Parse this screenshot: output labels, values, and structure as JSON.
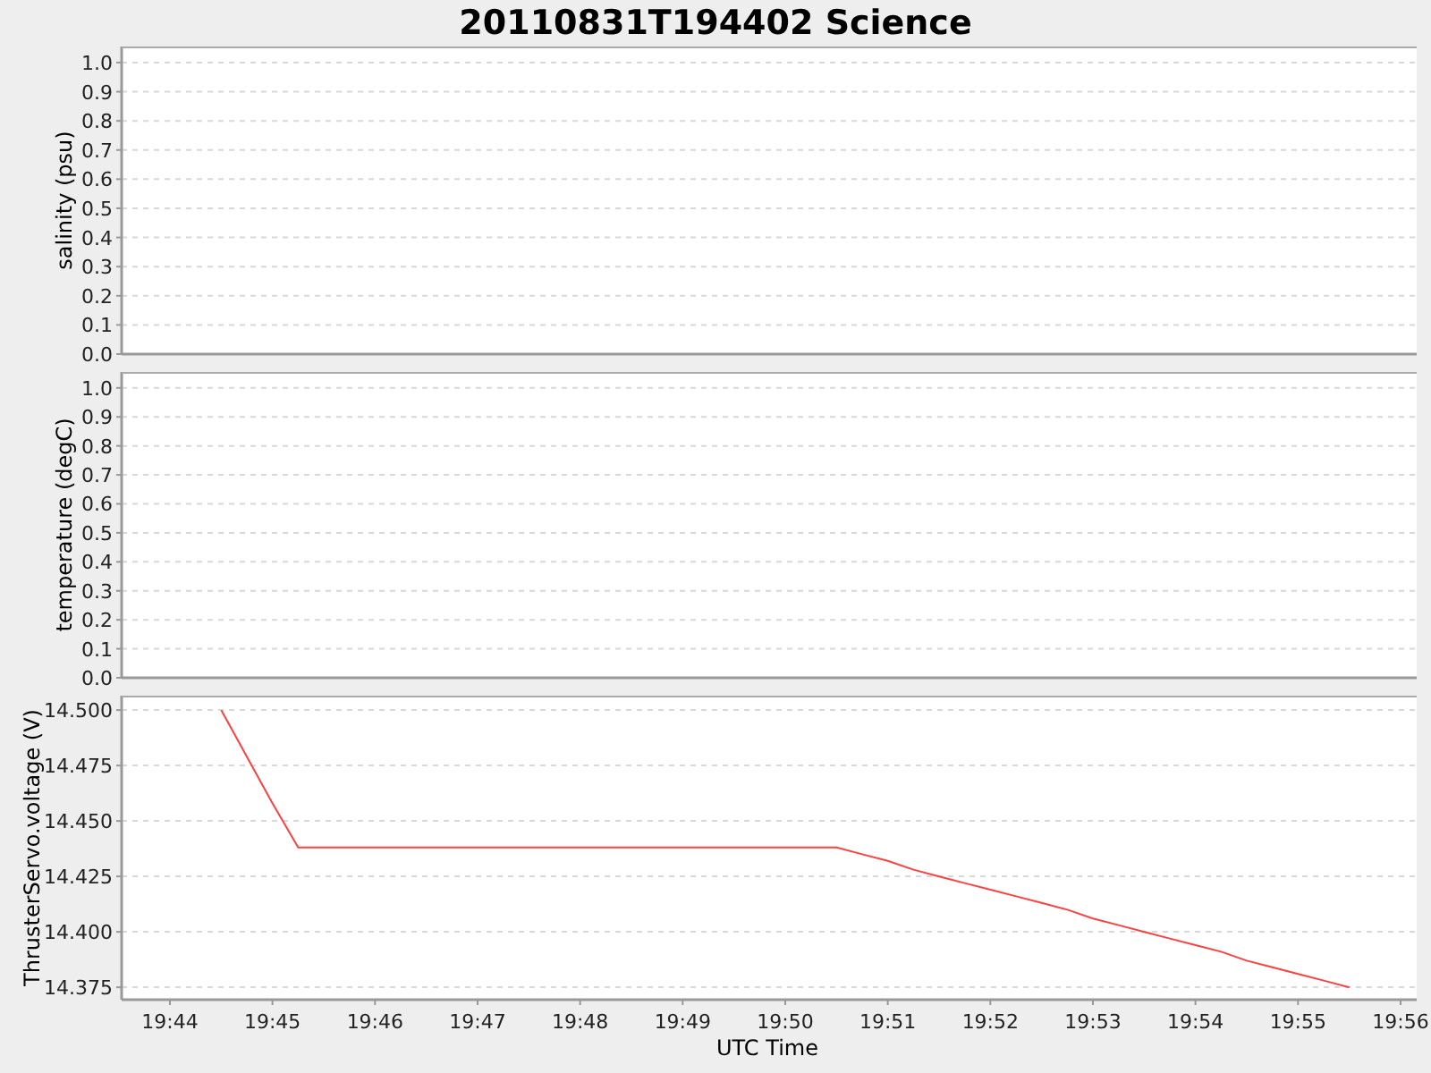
{
  "title": "20110831T194402 Science",
  "panels": [
    {
      "chart_data": {
        "type": "line",
        "ylabel": "salinity (psu)",
        "grid": true,
        "categories": [
          null,
          null,
          null,
          null,
          null,
          null,
          null,
          null,
          null,
          null,
          null,
          null,
          null
        ],
        "ylim": [
          0,
          1.055
        ],
        "yticks": [
          {
            "value": 0,
            "label": "0.0"
          },
          {
            "value": 0.1,
            "label": "0.1"
          },
          {
            "value": 0.2,
            "label": "0.2"
          },
          {
            "value": 0.3,
            "label": "0.3"
          },
          {
            "value": 0.4,
            "label": "0.4"
          },
          {
            "value": 0.5,
            "label": "0.5"
          },
          {
            "value": 0.6,
            "label": "0.6"
          },
          {
            "value": 0.7,
            "label": "0.7"
          },
          {
            "value": 0.8,
            "label": "0.8"
          },
          {
            "value": 0.9,
            "label": "0.9"
          },
          {
            "value": 1,
            "label": "1.0"
          }
        ]
      }
    },
    {
      "chart_data": {
        "type": "line",
        "ylabel": "temperature (degC)",
        "grid": true,
        "categories": [
          null,
          null,
          null,
          null,
          null,
          null,
          null,
          null,
          null,
          null,
          null,
          null,
          null
        ],
        "ylim": [
          0,
          1.055
        ],
        "yticks": [
          {
            "value": 0,
            "label": "0.0"
          },
          {
            "value": 0.1,
            "label": "0.1"
          },
          {
            "value": 0.2,
            "label": "0.2"
          },
          {
            "value": 0.3,
            "label": "0.3"
          },
          {
            "value": 0.4,
            "label": "0.4"
          },
          {
            "value": 0.5,
            "label": "0.5"
          },
          {
            "value": 0.6,
            "label": "0.6"
          },
          {
            "value": 0.7,
            "label": "0.7"
          },
          {
            "value": 0.8,
            "label": "0.8"
          },
          {
            "value": 0.9,
            "label": "0.9"
          },
          {
            "value": 1,
            "label": "1.0"
          }
        ]
      }
    },
    {
      "chart_data": {
        "type": "line",
        "ylabel": "ThrusterServo.voltage (V)",
        "xlabel": "UTC Time",
        "grid": true,
        "ylim": [
          14.3694,
          14.5065
        ],
        "yticks": [
          {
            "value": 14.375,
            "label": "14.375"
          },
          {
            "value": 14.4,
            "label": "14.400"
          },
          {
            "value": 14.425,
            "label": "14.425"
          },
          {
            "value": 14.45,
            "label": "14.450"
          },
          {
            "value": 14.475,
            "label": "14.475"
          },
          {
            "value": 14.5,
            "label": "14.500"
          }
        ],
        "categories": [
          "19:44",
          null,
          null,
          null,
          "19:45",
          null,
          null,
          null,
          "19:46",
          null,
          null,
          null,
          "19:47",
          null,
          null,
          null,
          "19:48",
          null,
          null,
          null,
          "19:49",
          null,
          null,
          null,
          "19:50",
          null,
          null,
          null,
          "19:51",
          null,
          null,
          null,
          "19:52",
          null,
          null,
          null,
          "19:53",
          null,
          null,
          null,
          "19:54",
          null,
          null,
          null,
          "19:55",
          null,
          null,
          null,
          "19:56"
        ],
        "series": [
          {
            "color": "#ff4040",
            "values": [
              null,
              null,
              14.5,
              14.479,
              14.458,
              14.438,
              14.438,
              14.438,
              14.438,
              14.438,
              14.438,
              14.438,
              14.438,
              14.438,
              14.438,
              14.438,
              14.438,
              14.438,
              14.438,
              14.438,
              14.438,
              14.438,
              14.438,
              14.438,
              14.438,
              14.438,
              14.438,
              14.435,
              14.432,
              14.428,
              14.425,
              14.422,
              14.419,
              14.416,
              14.413,
              14.41,
              14.406,
              14.403,
              14.4,
              14.397,
              14.394,
              14.391,
              14.387,
              14.384,
              14.381,
              14.378,
              14.375,
              null,
              null
            ]
          }
        ]
      }
    }
  ]
}
